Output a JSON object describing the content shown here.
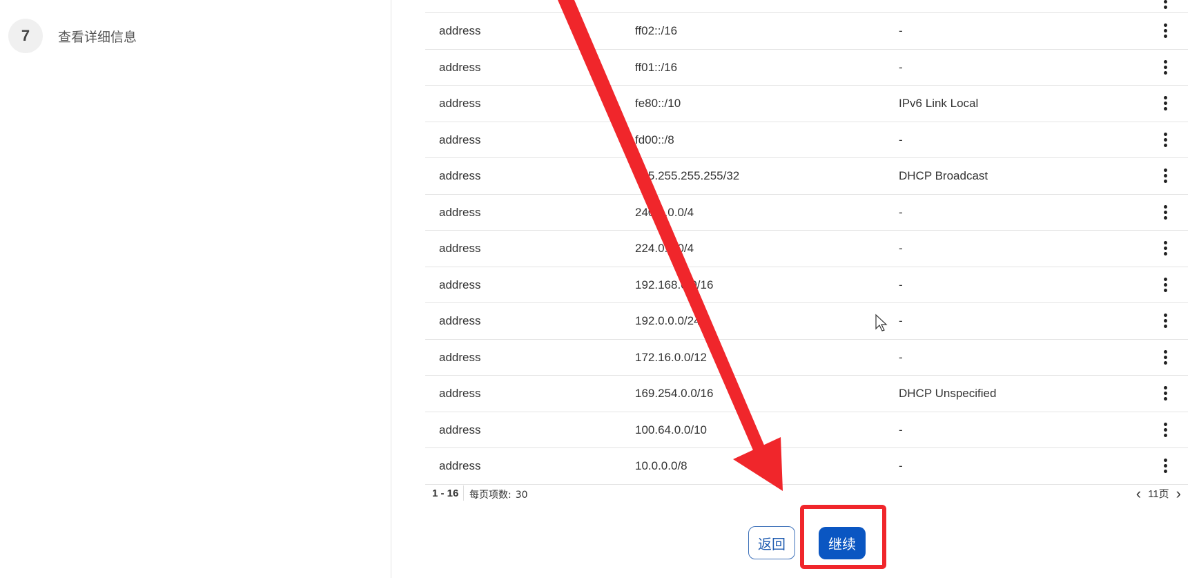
{
  "steps": [
    {
      "number": "7",
      "label": "查看详细信息"
    }
  ],
  "table": {
    "rows": [
      {
        "type": "",
        "value": "",
        "description": ""
      },
      {
        "type": "address",
        "value": "ff02::/16",
        "description": "-"
      },
      {
        "type": "address",
        "value": "ff01::/16",
        "description": "-"
      },
      {
        "type": "address",
        "value": "fe80::/10",
        "description": "IPv6 Link Local"
      },
      {
        "type": "address",
        "value": "fd00::/8",
        "description": "-"
      },
      {
        "type": "address",
        "value": "255.255.255.255/32",
        "description": "DHCP Broadcast"
      },
      {
        "type": "address",
        "value": "240.0.0.0/4",
        "description": "-"
      },
      {
        "type": "address",
        "value": "224.0.0.0/4",
        "description": "-"
      },
      {
        "type": "address",
        "value": "192.168.0.0/16",
        "description": "-"
      },
      {
        "type": "address",
        "value": "192.0.0.0/24",
        "description": "-"
      },
      {
        "type": "address",
        "value": "172.16.0.0/12",
        "description": "-"
      },
      {
        "type": "address",
        "value": "169.254.0.0/16",
        "description": "DHCP Unspecified"
      },
      {
        "type": "address",
        "value": "100.64.0.0/10",
        "description": "-"
      },
      {
        "type": "address",
        "value": "10.0.0.0/8",
        "description": "-"
      }
    ]
  },
  "pagination": {
    "range": "1 - 16",
    "per_page_label": "每页项数:",
    "per_page_value": "30",
    "page_text": "11页",
    "prev_glyph": "‹",
    "next_glyph": "›"
  },
  "buttons": {
    "back": "返回",
    "continue": "继续"
  },
  "annotation": {
    "arrow_color": "#f0262b",
    "box_color": "#f0262b"
  },
  "colors": {
    "primary": "#0a56c2",
    "border": "#e3e3e3"
  }
}
